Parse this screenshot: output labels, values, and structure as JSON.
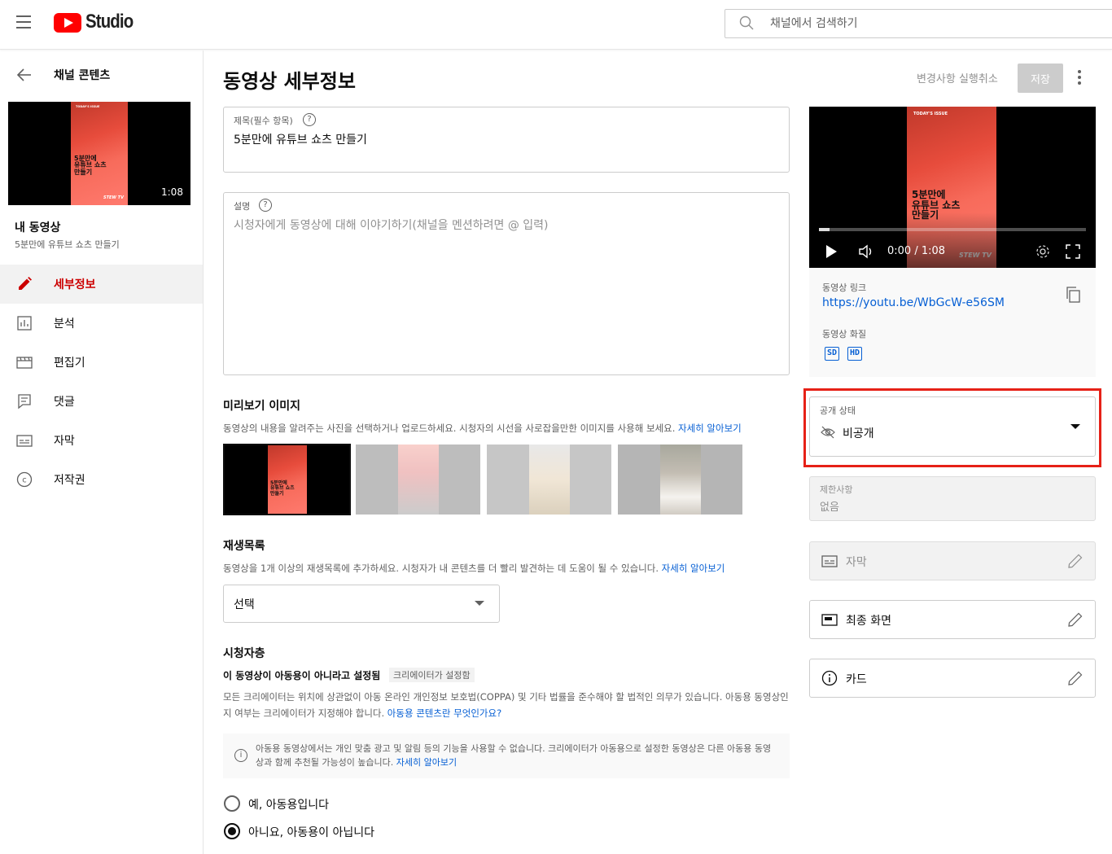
{
  "header": {
    "logo_text": "Studio",
    "search_placeholder": "채널에서 검색하기"
  },
  "sidebar": {
    "back_label": "채널 콘텐츠",
    "thumbnail": {
      "duration": "1:08",
      "poster_title": "5분만에\n유튜브 쇼츠\n만들기",
      "poster_tag": "STEW TV",
      "poster_issue": "TODAY'S ISSUE"
    },
    "my_videos_label": "내 동영상",
    "video_title": "5분만에 유튜브 쇼츠 만들기",
    "nav": [
      {
        "label": "세부정보",
        "icon": "pencil-icon",
        "active": true
      },
      {
        "label": "분석",
        "icon": "analytics-icon",
        "active": false
      },
      {
        "label": "편집기",
        "icon": "editor-icon",
        "active": false
      },
      {
        "label": "댓글",
        "icon": "comments-icon",
        "active": false
      },
      {
        "label": "자막",
        "icon": "subtitles-icon",
        "active": false
      },
      {
        "label": "저작권",
        "icon": "copyright-icon",
        "active": false
      }
    ]
  },
  "main": {
    "page_title": "동영상 세부정보",
    "undo_label": "변경사항 실행취소",
    "save_label": "저장",
    "title_field": {
      "label": "제목(필수 항목)",
      "value": "5분만에 유튜브 쇼츠 만들기"
    },
    "description_field": {
      "label": "설명",
      "placeholder": "시청자에게 동영상에 대해 이야기하기(채널을 멘션하려면 @ 입력)"
    },
    "thumbnail_section": {
      "heading": "미리보기 이미지",
      "description": "동영상의 내용을 알려주는 사진을 선택하거나 업로드하세요. 시청자의 시선을 사로잡을만한 이미지를 사용해 보세요.",
      "learn_more": "자세히 알아보기"
    },
    "playlist_section": {
      "heading": "재생목록",
      "description": "동영상을 1개 이상의 재생목록에 추가하세요. 시청자가 내 콘텐츠를 더 빨리 발견하는 데 도움이 될 수 있습니다.",
      "learn_more": "자세히 알아보기",
      "select_value": "선택"
    },
    "audience_section": {
      "heading": "시청자층",
      "status_text": "이 동영상이 아동용이 아니라고 설정됨",
      "badge": "크리에이터가 설정함",
      "description": "모든 크리에이터는 위치에 상관없이 아동 온라인 개인정보 보호법(COPPA) 및 기타 법률을 준수해야 할 법적인 의무가 있습니다. 아동용 동영상인지 여부는 크리에이터가 지정해야 합니다.",
      "description_link": "아동용 콘텐츠란 무엇인가요?",
      "info_text": "아동용 동영상에서는 개인 맞춤 광고 및 알림 등의 기능을 사용할 수 없습니다. 크리에이터가 아동용으로 설정한 동영상은 다른 아동용 동영상과 함께 추천될 가능성이 높습니다.",
      "info_link": "자세히 알아보기",
      "option_yes": "예, 아동용입니다",
      "option_no": "아니요, 아동용이 아닙니다"
    }
  },
  "player": {
    "time": "0:00 / 1:08",
    "progress_fraction": 0.04
  },
  "meta": {
    "link_label": "동영상 링크",
    "link_url": "https://youtu.be/WbGcW-e56SM",
    "quality_label": "동영상 화질",
    "quality_badges": [
      "SD",
      "HD"
    ]
  },
  "visibility": {
    "label": "공개 상태",
    "value": "비공개"
  },
  "restrictions": {
    "label": "제한사항",
    "value": "없음"
  },
  "cards": [
    {
      "label": "자막",
      "icon": "subtitles-icon",
      "disabled": true
    },
    {
      "label": "최종 화면",
      "icon": "end-screen-icon",
      "disabled": false
    },
    {
      "label": "카드",
      "icon": "info-icon",
      "disabled": false
    }
  ],
  "colors": {
    "brand_red": "#ff0000",
    "active_nav": "#cc0000",
    "link_blue": "#065fd4",
    "highlight_border": "#e62117"
  }
}
